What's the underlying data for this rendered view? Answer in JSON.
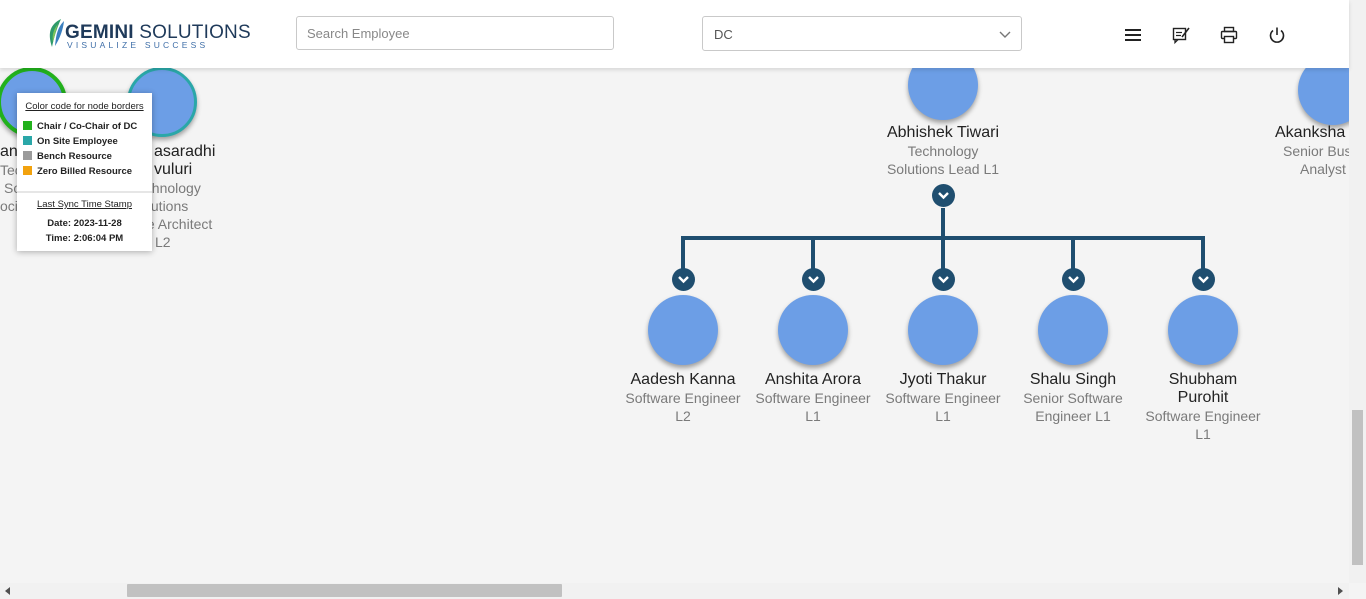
{
  "header": {
    "logo": {
      "brand_bold": "GEMINI",
      "brand_light": " SOLUTIONS",
      "tagline": "VISUALIZE SUCCESS"
    },
    "search": {
      "placeholder": "Search Employee",
      "value": ""
    },
    "department_select": {
      "selected": "DC"
    },
    "icons": [
      "menu-icon",
      "feedback-icon",
      "print-icon",
      "power-icon"
    ]
  },
  "legend": {
    "title": "Color code for node borders",
    "items": [
      {
        "label": "Chair / Co-Chair of DC",
        "color": "#22b11c"
      },
      {
        "label": "On Site Employee",
        "color": "#2aa7a8"
      },
      {
        "label": "Bench Resource",
        "color": "#9b9b9b"
      },
      {
        "label": "Zero Billed Resource",
        "color": "#f2a20e"
      }
    ],
    "sync_title": "Last Sync Time Stamp",
    "sync_date": "Date: 2023-11-28",
    "sync_time": "Time: 2:06:04 PM"
  },
  "left_nodes": {
    "node1": {
      "name": "an",
      "line1": "Tec",
      "line2": "Solutions",
      "line3": "ocia",
      "border_color": "#22b11c"
    },
    "node2": {
      "name_l1": "asaradhi",
      "name_l2": "vuluri",
      "line1": "Technology",
      "line2": "olutions",
      "line3": "te Architect",
      "line4": "L2",
      "border_color": "#2aa7a8"
    }
  },
  "parent": {
    "name": "Abhishek Tiwari",
    "desig_l1": "Technology",
    "desig_l2": "Solutions Lead L1"
  },
  "right_partial": {
    "name": "Akanksha",
    "desig_l1": "Senior Bus",
    "desig_l2": "Analyst"
  },
  "children": [
    {
      "name": "Aadesh Kanna",
      "desig_l1": "Software Engineer",
      "desig_l2": "L2"
    },
    {
      "name": "Anshita Arora",
      "desig_l1": "Software Engineer",
      "desig_l2": "L1"
    },
    {
      "name": "Jyoti Thakur",
      "desig_l1": "Software Engineer",
      "desig_l2": "L1"
    },
    {
      "name": "Shalu Singh",
      "desig_l1": "Senior Software",
      "desig_l2": "Engineer L1"
    },
    {
      "name": "Shubham",
      "name_l2": "Purohit",
      "desig_l1": "Software Engineer",
      "desig_l2": "L1"
    }
  ],
  "colors": {
    "node_fill": "#6c9ee6",
    "connector": "#1f4e6f",
    "header_bg": "#ffffff",
    "canvas_bg": "#f4f4f4"
  }
}
